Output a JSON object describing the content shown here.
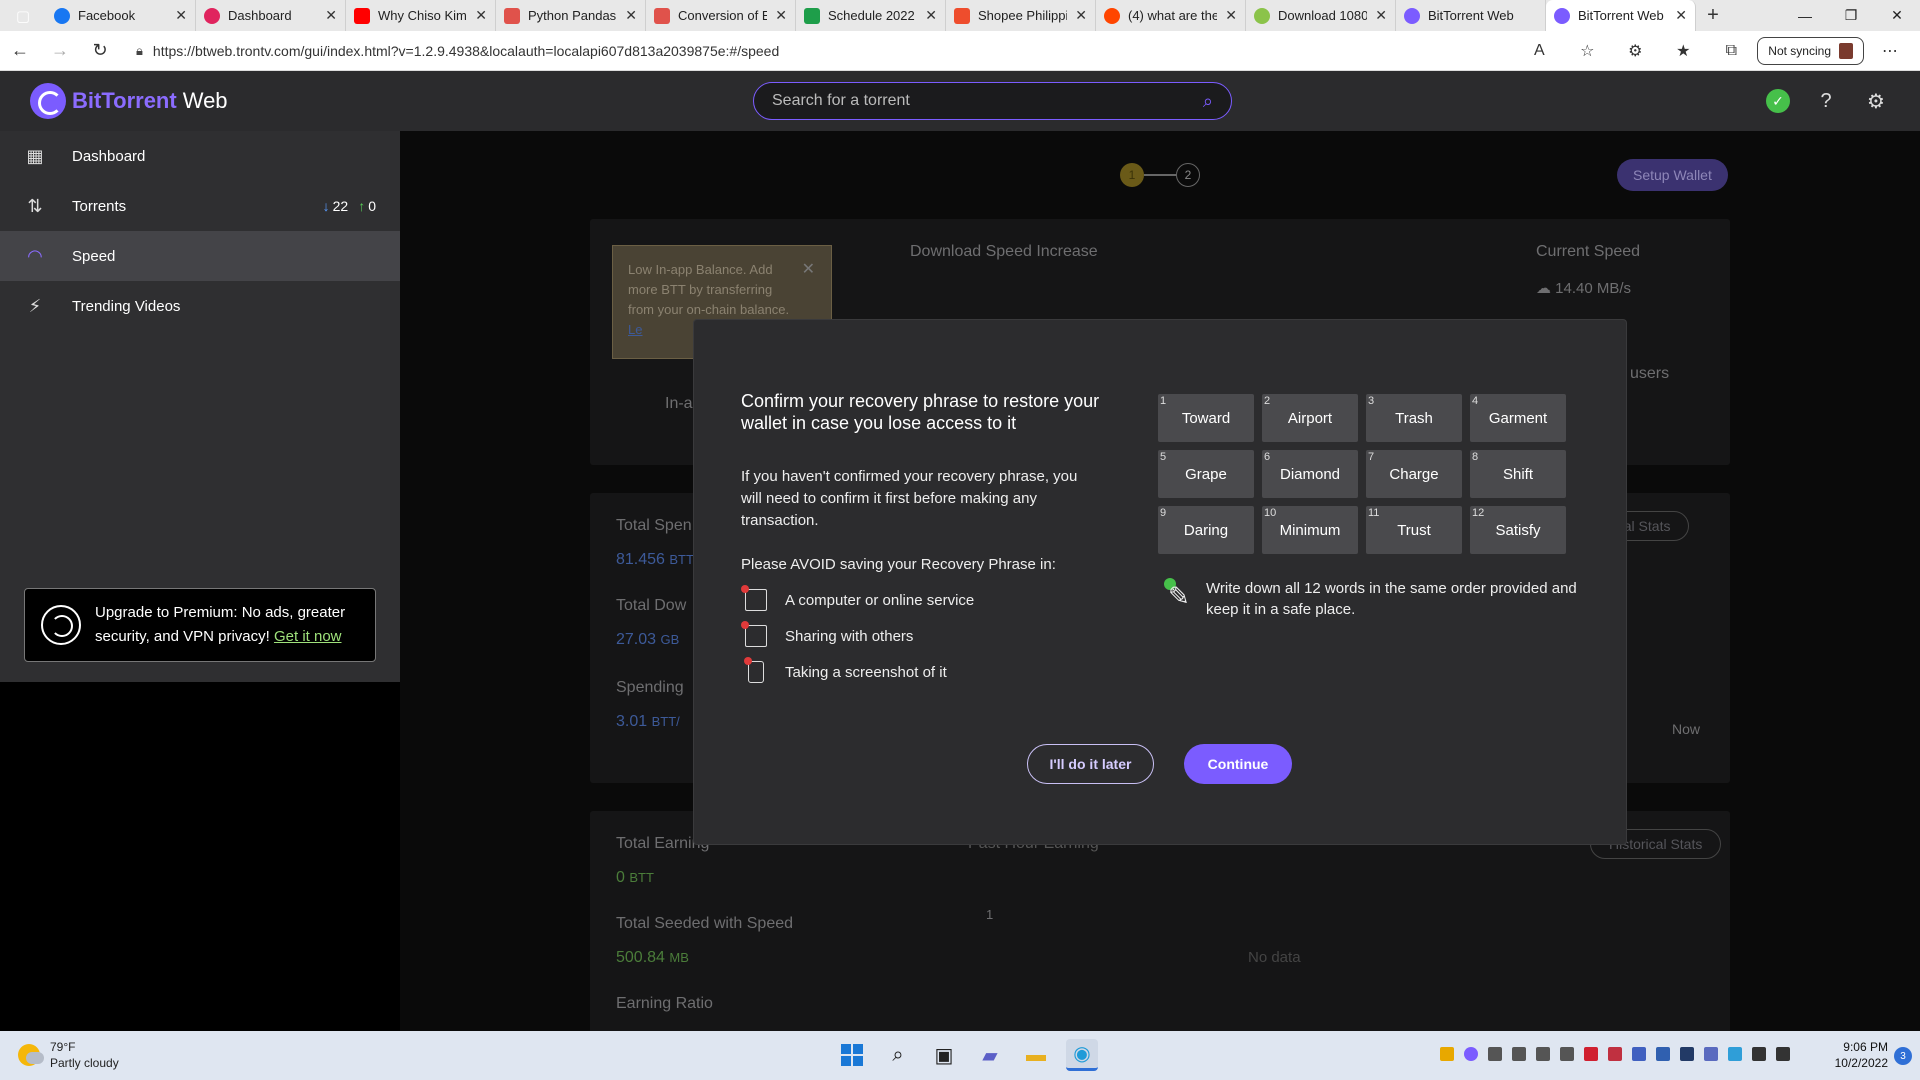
{
  "browser": {
    "tabs": [
      {
        "title": "Facebook",
        "color": "#1877f2"
      },
      {
        "title": "Dashboard",
        "color": "#e0245e"
      },
      {
        "title": "Why Chiso Kim",
        "color": "#ff0000"
      },
      {
        "title": "Python Pandas",
        "color": "#e0524b"
      },
      {
        "title": "Conversion of E",
        "color": "#e0524b"
      },
      {
        "title": "Schedule 2022",
        "color": "#1e9e4a"
      },
      {
        "title": "Shopee Philippi",
        "color": "#ee4d2d"
      },
      {
        "title": "(4) what are the",
        "color": "#ff4500"
      },
      {
        "title": "Download 1080",
        "color": "#8bc34a"
      },
      {
        "title": "BitTorrent Web",
        "color": "#7b5cff"
      },
      {
        "title": "BitTorrent Web",
        "color": "#7b5cff"
      }
    ],
    "url": "https://btweb.trontv.com/gui/index.html?v=1.2.9.4938&localauth=localapi607d813a2039875e:#/speed",
    "sync_label": "Not syncing"
  },
  "app": {
    "brand": "BitTorrent",
    "brand_suffix": "Web",
    "search_placeholder": "Search for a torrent"
  },
  "sidebar": {
    "items": [
      {
        "label": "Dashboard",
        "icon": "grid-icon"
      },
      {
        "label": "Torrents",
        "icon": "transfer-icon",
        "down": "22",
        "up": "0"
      },
      {
        "label": "Speed",
        "icon": "speedometer-icon"
      },
      {
        "label": "Trending Videos",
        "icon": "video-icon"
      }
    ],
    "premium_text": "Upgrade to Premium: No ads, greater security, and VPN privacy!",
    "premium_link": "Get it now"
  },
  "background": {
    "steps": [
      "1",
      "2"
    ],
    "setup_wallet": "Setup Wallet",
    "low_balance": "Low In-app Balance. Add more BTT by transferring from your on-chain balance.",
    "low_balance_link": "Le",
    "in_app": "In-a",
    "download_speed_increase": "Download Speed Increase",
    "current_speed": "Current Speed",
    "current_speed_val": "14.40 MB/s",
    "users": "users",
    "total_spent": "Total Spen",
    "total_spent_val": "81.456",
    "total_spent_unit": "BTT",
    "total_down": "Total Dow",
    "total_down_val": "27.03",
    "total_down_unit": "GB",
    "spending": "Spending",
    "spending_val": "3.01",
    "spending_unit": "BTT/",
    "hist_stats_partial": "rical Stats",
    "now": "Now",
    "total_earning": "Total Earning",
    "total_earning_val": "0",
    "total_earning_unit": "BTT",
    "past_hour_earning": "Past Hour Earning",
    "historical_stats": "Historical Stats",
    "total_seeded": "Total Seeded with Speed",
    "total_seeded_val": "500.84",
    "total_seeded_unit": "MB",
    "earning_ratio": "Earning Ratio",
    "axis_one": "1",
    "no_data": "No data"
  },
  "modal": {
    "title": "Confirm your recovery phrase to restore your wallet in case you lose access to it",
    "body": "If you haven't confirmed your recovery phrase, you will need to confirm it first before making any transaction.",
    "avoid_heading": "Please AVOID saving your Recovery Phrase in:",
    "avoid_items": [
      "A computer or online service",
      "Sharing with others",
      "Taking a screenshot of it"
    ],
    "words": [
      {
        "n": "1",
        "w": "Toward"
      },
      {
        "n": "2",
        "w": "Airport"
      },
      {
        "n": "3",
        "w": "Trash"
      },
      {
        "n": "4",
        "w": "Garment"
      },
      {
        "n": "5",
        "w": "Grape"
      },
      {
        "n": "6",
        "w": "Diamond"
      },
      {
        "n": "7",
        "w": "Charge"
      },
      {
        "n": "8",
        "w": "Shift"
      },
      {
        "n": "9",
        "w": "Daring"
      },
      {
        "n": "10",
        "w": "Minimum"
      },
      {
        "n": "11",
        "w": "Trust"
      },
      {
        "n": "12",
        "w": "Satisfy"
      }
    ],
    "tip": "Write down all 12 words in the same order provided and keep it in a safe place.",
    "later_label": "I'll do it later",
    "continue_label": "Continue"
  },
  "taskbar": {
    "temp": "79°F",
    "weather": "Partly cloudy",
    "time": "9:06 PM",
    "date": "10/2/2022",
    "notifications": "3"
  }
}
